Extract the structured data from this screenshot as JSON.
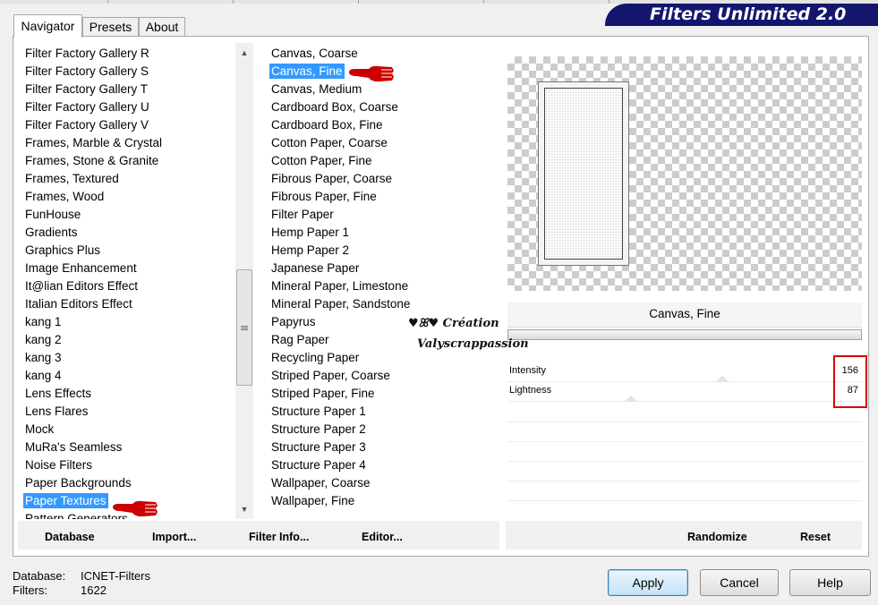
{
  "title": "Filters Unlimited 2.0",
  "tabs": [
    {
      "label": "Navigator",
      "active": true
    },
    {
      "label": "Presets",
      "active": false
    },
    {
      "label": "About",
      "active": false
    }
  ],
  "categories": [
    "Filter Factory Gallery R",
    "Filter Factory Gallery S",
    "Filter Factory Gallery T",
    "Filter Factory Gallery U",
    "Filter Factory Gallery V",
    "Frames, Marble & Crystal",
    "Frames, Stone & Granite",
    "Frames, Textured",
    "Frames, Wood",
    "FunHouse",
    "Gradients",
    "Graphics Plus",
    "Image Enhancement",
    "It@lian Editors Effect",
    "Italian Editors Effect",
    "kang 1",
    "kang 2",
    "kang 3",
    "kang 4",
    "Lens Effects",
    "Lens Flares",
    "Mock",
    "MuRa's Seamless",
    "Noise Filters",
    "Paper Backgrounds",
    "Paper Textures",
    "Pattern Generators"
  ],
  "selected_category": "Paper Textures",
  "filters": [
    "Canvas, Coarse",
    "Canvas, Fine",
    "Canvas, Medium",
    "Cardboard Box, Coarse",
    "Cardboard Box, Fine",
    "Cotton Paper, Coarse",
    "Cotton Paper, Fine",
    "Fibrous Paper, Coarse",
    "Fibrous Paper, Fine",
    "Filter Paper",
    "Hemp Paper 1",
    "Hemp Paper 2",
    "Japanese Paper",
    "Mineral Paper, Limestone",
    "Mineral Paper, Sandstone",
    "Papyrus",
    "Rag Paper",
    "Recycling Paper",
    "Striped Paper, Coarse",
    "Striped Paper, Fine",
    "Structure Paper 1",
    "Structure Paper 2",
    "Structure Paper 3",
    "Structure Paper 4",
    "Wallpaper, Coarse",
    "Wallpaper, Fine"
  ],
  "selected_filter": "Canvas, Fine",
  "preview_filter_name": "Canvas, Fine",
  "params": [
    {
      "label": "Intensity",
      "value": "156",
      "max": 255
    },
    {
      "label": "Lightness",
      "value": "87",
      "max": 255
    }
  ],
  "footer_buttons": {
    "database": "Database",
    "import": "Import...",
    "filter_info": "Filter Info...",
    "editor": "Editor...",
    "randomize": "Randomize",
    "reset": "Reset"
  },
  "status": {
    "database_label": "Database:",
    "database_value": "ICNET-Filters",
    "filters_label": "Filters:",
    "filters_value": "1622"
  },
  "buttons": {
    "apply": "Apply",
    "cancel": "Cancel",
    "help": "Help"
  },
  "watermark": {
    "line1": "♥ꕤ♥ Création",
    "line2": "Valyscrappassion"
  },
  "colors": {
    "banner": "#14166e",
    "selection": "#3399ff",
    "highlight_box": "#d40000",
    "pointer": "#cc0000"
  }
}
